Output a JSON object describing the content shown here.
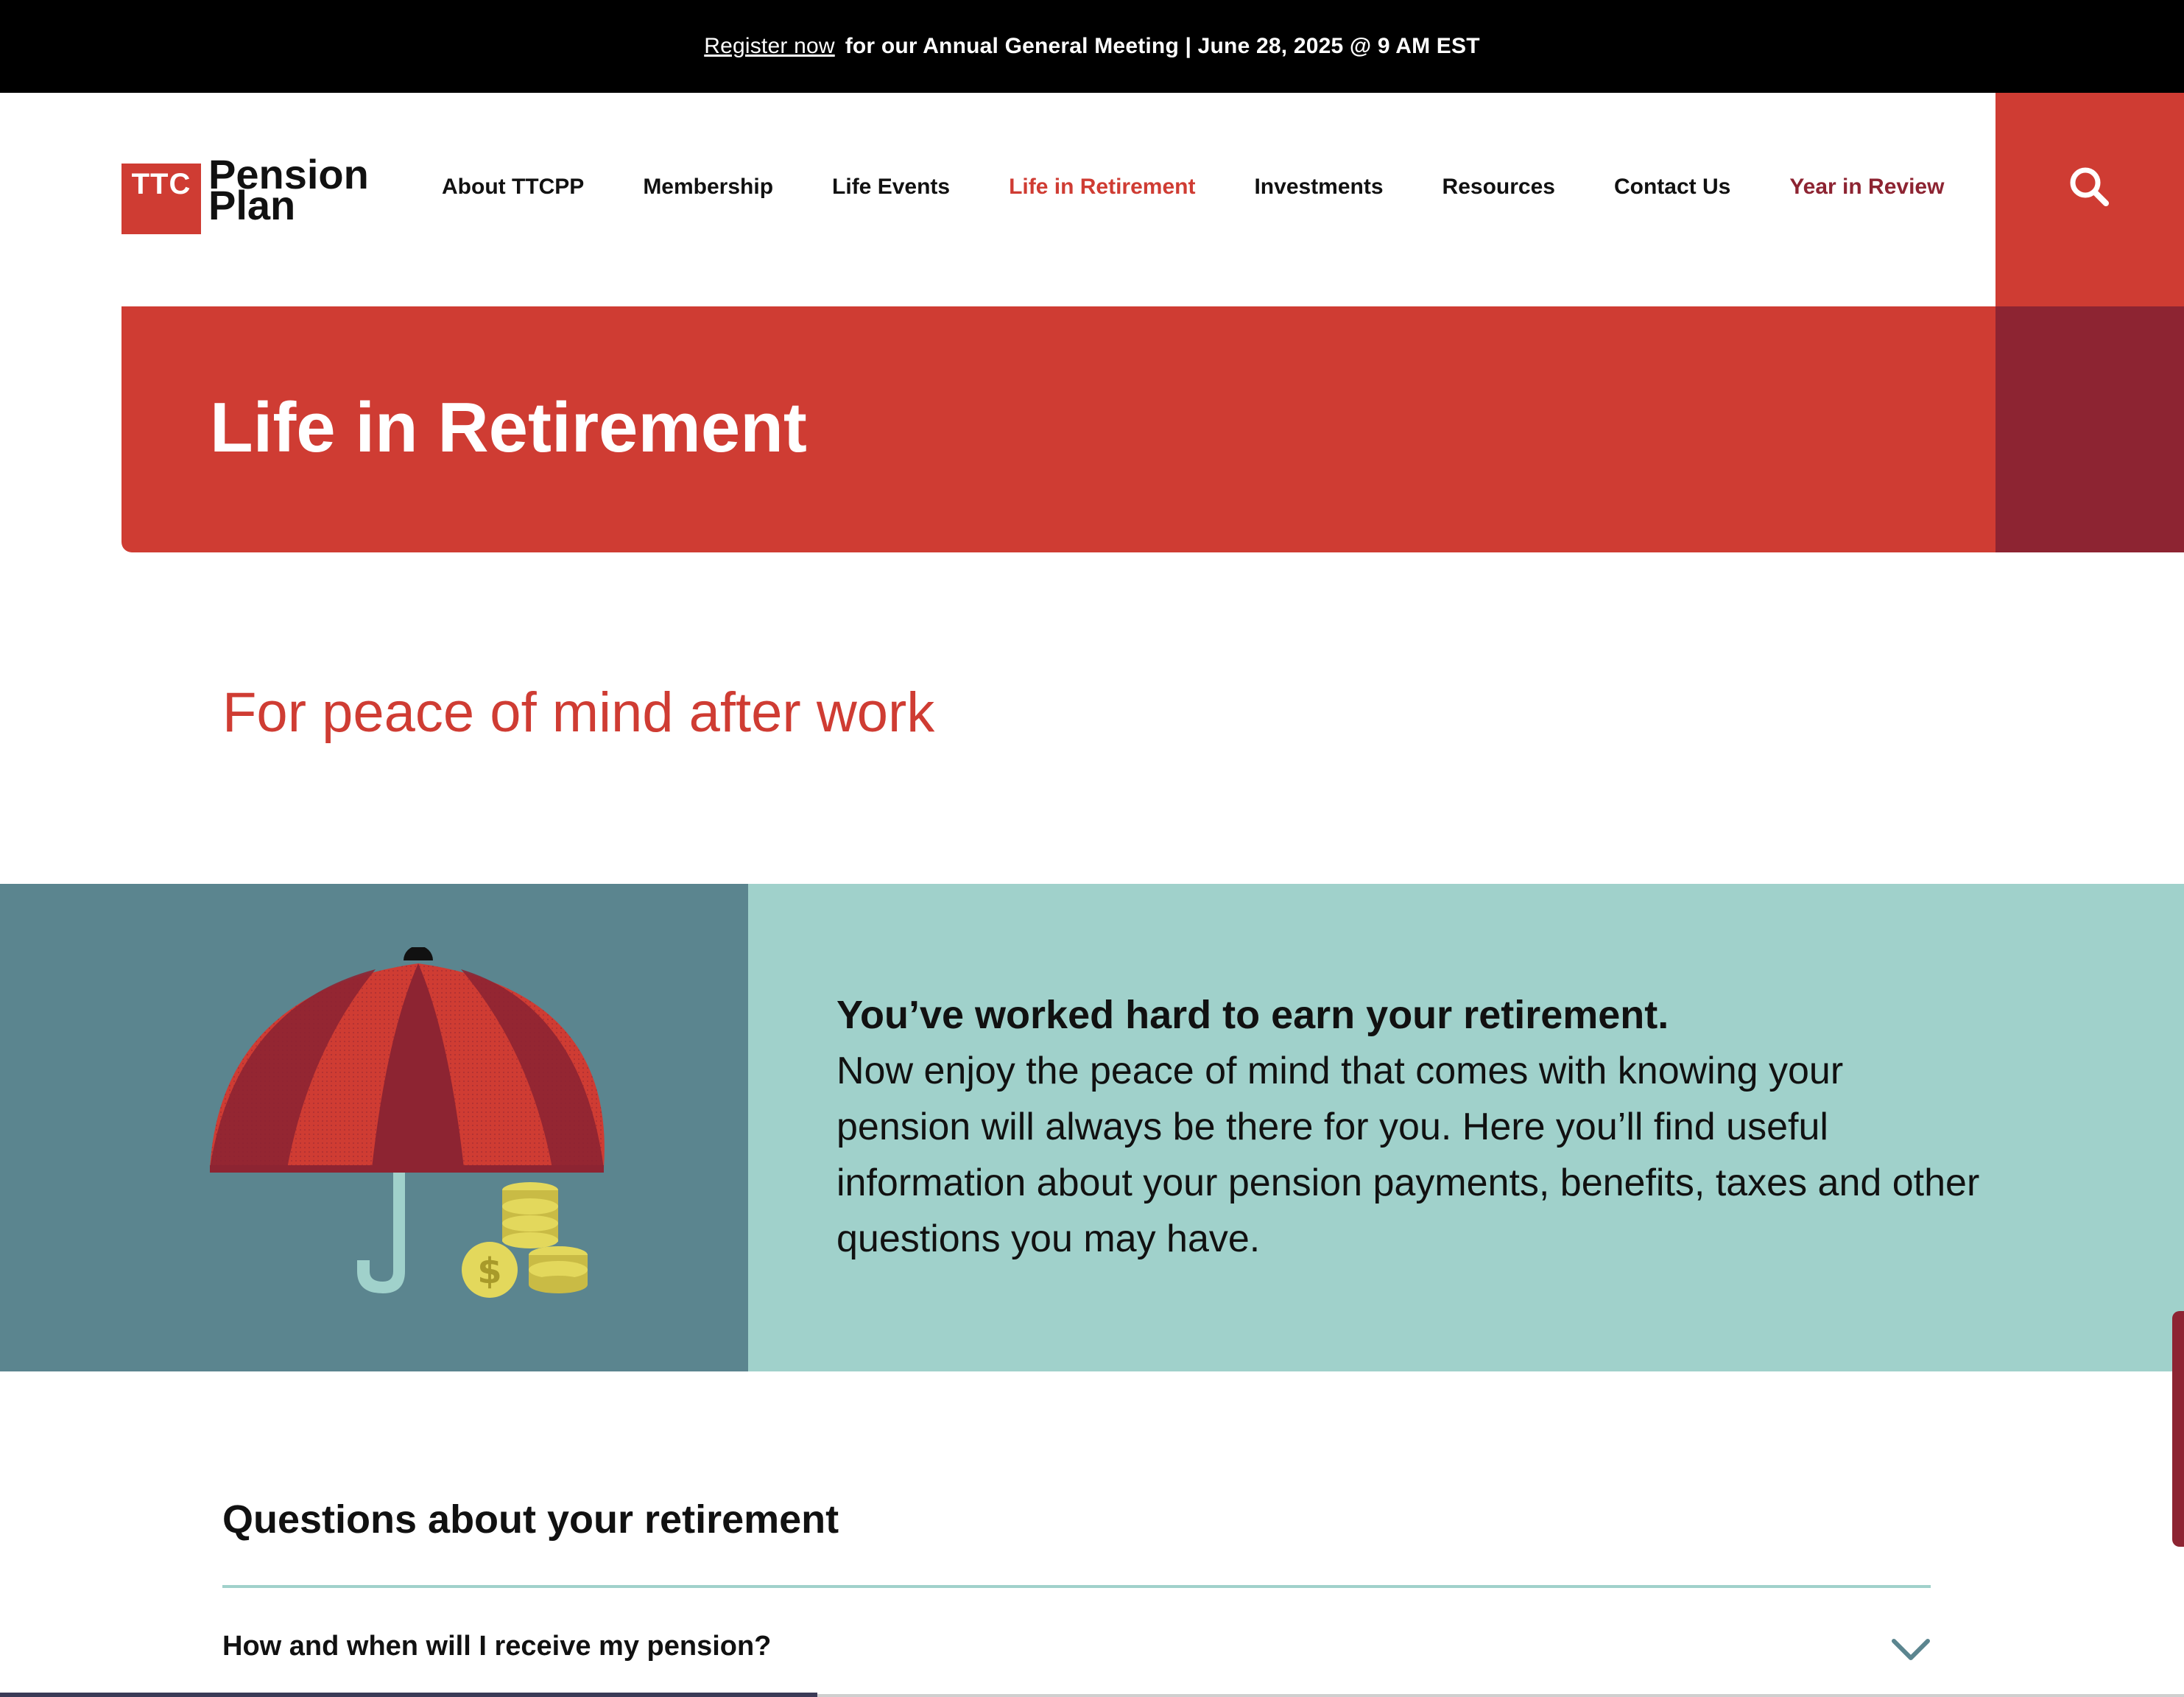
{
  "announcement": {
    "link_label": "Register now",
    "text": "for our Annual General Meeting | June 28, 2025 @ 9 AM EST"
  },
  "brand": {
    "logo_badge": "TTC",
    "logo_line1": "Pension",
    "logo_line2": "Plan"
  },
  "nav": {
    "items": [
      {
        "label": "About TTCPP"
      },
      {
        "label": "Membership"
      },
      {
        "label": "Life Events"
      },
      {
        "label": "Life in Retirement",
        "active": true
      },
      {
        "label": "Investments"
      },
      {
        "label": "Resources"
      },
      {
        "label": "Contact Us"
      },
      {
        "label": "Year in Review"
      }
    ],
    "search_icon": "search-icon"
  },
  "hero": {
    "title": "Life in Retirement"
  },
  "intro": {
    "subheading": "For peace of mind after work"
  },
  "feature": {
    "illustration_icon": "umbrella-coins-icon",
    "title": "You’ve worked hard to earn your retirement.",
    "body": "Now enjoy the peace of mind that comes with knowing your pension will always be there for you. Here you’ll find useful information about your pension payments, benefits, taxes and other questions you may have."
  },
  "questions": {
    "heading": "Questions about your retirement",
    "items": [
      {
        "question": "How and when will I receive my pension?",
        "icon": "chevron-down-icon"
      }
    ]
  },
  "colors": {
    "brand_red": "#cf3c33",
    "dark_red": "#8d2432",
    "teal_dark": "#5b858f",
    "teal_light": "#a0d1cb",
    "black": "#000000"
  }
}
